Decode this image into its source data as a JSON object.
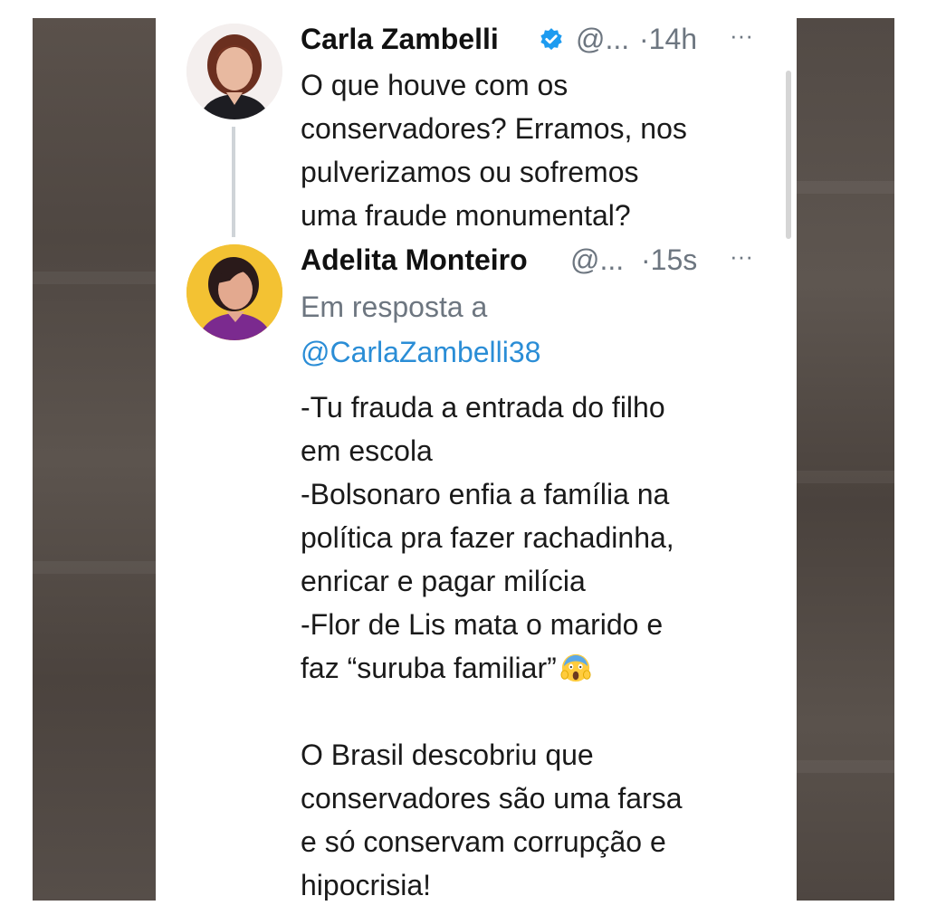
{
  "tweet1": {
    "name": "Carla Zambelli",
    "handle": "@...",
    "time": "·14h",
    "more": "···",
    "lines": [
      "O que houve com os",
      "conservadores? Erramos, nos",
      "pulverizamos ou sofremos",
      "uma fraude monumental?"
    ]
  },
  "tweet2": {
    "name": "Adelita Monteiro",
    "handle": "@...",
    "time": "·15s",
    "more": "···",
    "reply_label": "Em resposta a",
    "reply_to": "@CarlaZambelli38",
    "lines": [
      "-Tu frauda a entrada do filho",
      "em escola",
      "-Bolsonaro enfia a família na",
      "política pra fazer rachadinha,",
      "enricar e pagar milícia",
      "-Flor de Lis mata o marido e",
      "faz “suruba familiar”",
      "",
      "O Brasil descobriu que",
      "conservadores são uma farsa",
      "e só conservam corrupção e",
      "hipocrisia!"
    ]
  },
  "colors": {
    "link": "#2a8dd6",
    "verified": "#1d9bf0",
    "avatar2_bg": "#f3c233"
  },
  "icons": {
    "verified": "verified-badge-icon",
    "emoji": "screaming-face-emoji"
  }
}
